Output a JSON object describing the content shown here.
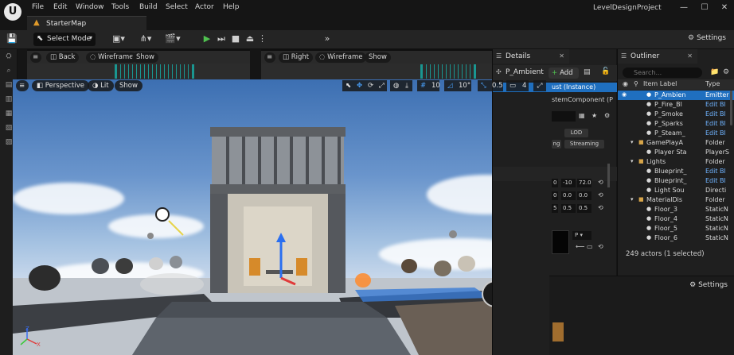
{
  "menu": {
    "items": [
      "File",
      "Edit",
      "Window",
      "Tools",
      "Build",
      "Select",
      "Actor",
      "Help"
    ],
    "project_name": "LevelDesignProject"
  },
  "level_tab": {
    "name": "StarterMap"
  },
  "toolbar": {
    "select_mode": "Select Mode",
    "settings": "Settings"
  },
  "mini_viewports": [
    {
      "nav": "Back",
      "mode": "Wireframe",
      "show": "Show"
    },
    {
      "nav": "Right",
      "mode": "Wireframe",
      "show": "Show"
    }
  ],
  "viewport": {
    "perspective": "Perspective",
    "lit": "Lit",
    "show": "Show",
    "grid_snap": "10",
    "rotation_snap": "10°",
    "scale_snap": "0.5",
    "camera_speed": "4",
    "axis_z": "Z",
    "axis_x": "X"
  },
  "details": {
    "title": "Details",
    "actor_name": "P_Ambient",
    "add_label": "Add",
    "instance_label": "ust (Instance)",
    "component_label": "stemComponent (P",
    "lod_label": "LOD",
    "streaming_label": "Streaming",
    "small_label": "ng",
    "transform_rows": [
      [
        "0",
        "-10",
        "72.0"
      ],
      [
        "0",
        "0.0",
        "0.0"
      ],
      [
        "5",
        "0.5",
        "0.5"
      ]
    ],
    "dropdown": "P"
  },
  "outliner": {
    "title": "Outliner",
    "search_placeholder": "Search...",
    "col_label": "Item Label",
    "col_type": "Type",
    "rows": [
      {
        "name": "P_Ambien",
        "type": "Emitter",
        "indent": 3,
        "selected": true,
        "folder": false,
        "link": false
      },
      {
        "name": "P_Fire_Bl",
        "type": "Edit Bl",
        "indent": 3,
        "selected": false,
        "folder": false,
        "link": true
      },
      {
        "name": "P_Smoke",
        "type": "Edit Bl",
        "indent": 3,
        "selected": false,
        "folder": false,
        "link": true
      },
      {
        "name": "P_Sparks",
        "type": "Edit Bl",
        "indent": 3,
        "selected": false,
        "folder": false,
        "link": true
      },
      {
        "name": "P_Steam_",
        "type": "Edit Bl",
        "indent": 3,
        "selected": false,
        "folder": false,
        "link": true
      },
      {
        "name": "GamePlayA",
        "type": "Folder",
        "indent": 2,
        "selected": false,
        "folder": true,
        "link": false
      },
      {
        "name": "Player Sta",
        "type": "PlayerS",
        "indent": 3,
        "selected": false,
        "folder": false,
        "link": false
      },
      {
        "name": "Lights",
        "type": "Folder",
        "indent": 2,
        "selected": false,
        "folder": true,
        "link": false
      },
      {
        "name": "Blueprint_",
        "type": "Edit Bl",
        "indent": 3,
        "selected": false,
        "folder": false,
        "link": true
      },
      {
        "name": "Blueprint_",
        "type": "Edit Bl",
        "indent": 3,
        "selected": false,
        "folder": false,
        "link": true
      },
      {
        "name": "Light Sou",
        "type": "Directi",
        "indent": 3,
        "selected": false,
        "folder": false,
        "link": false
      },
      {
        "name": "MaterialDis",
        "type": "Folder",
        "indent": 2,
        "selected": false,
        "folder": true,
        "link": false
      },
      {
        "name": "Floor_3",
        "type": "StaticN",
        "indent": 3,
        "selected": false,
        "folder": false,
        "link": false
      },
      {
        "name": "Floor_4",
        "type": "StaticN",
        "indent": 3,
        "selected": false,
        "folder": false,
        "link": false
      },
      {
        "name": "Floor_5",
        "type": "StaticN",
        "indent": 3,
        "selected": false,
        "folder": false,
        "link": false
      },
      {
        "name": "Floor_6",
        "type": "StaticN",
        "indent": 3,
        "selected": false,
        "folder": false,
        "link": false
      }
    ],
    "actor_count": "249 actors (1 selected)"
  },
  "bottom_panel": {
    "settings": "Settings"
  },
  "colors": {
    "accent_blue": "#1f6fbf",
    "play_green": "#4fc04f",
    "folder_gold": "#d8a64a",
    "link_blue": "#6fb3ff",
    "wireframe_teal": "#19a29c"
  }
}
